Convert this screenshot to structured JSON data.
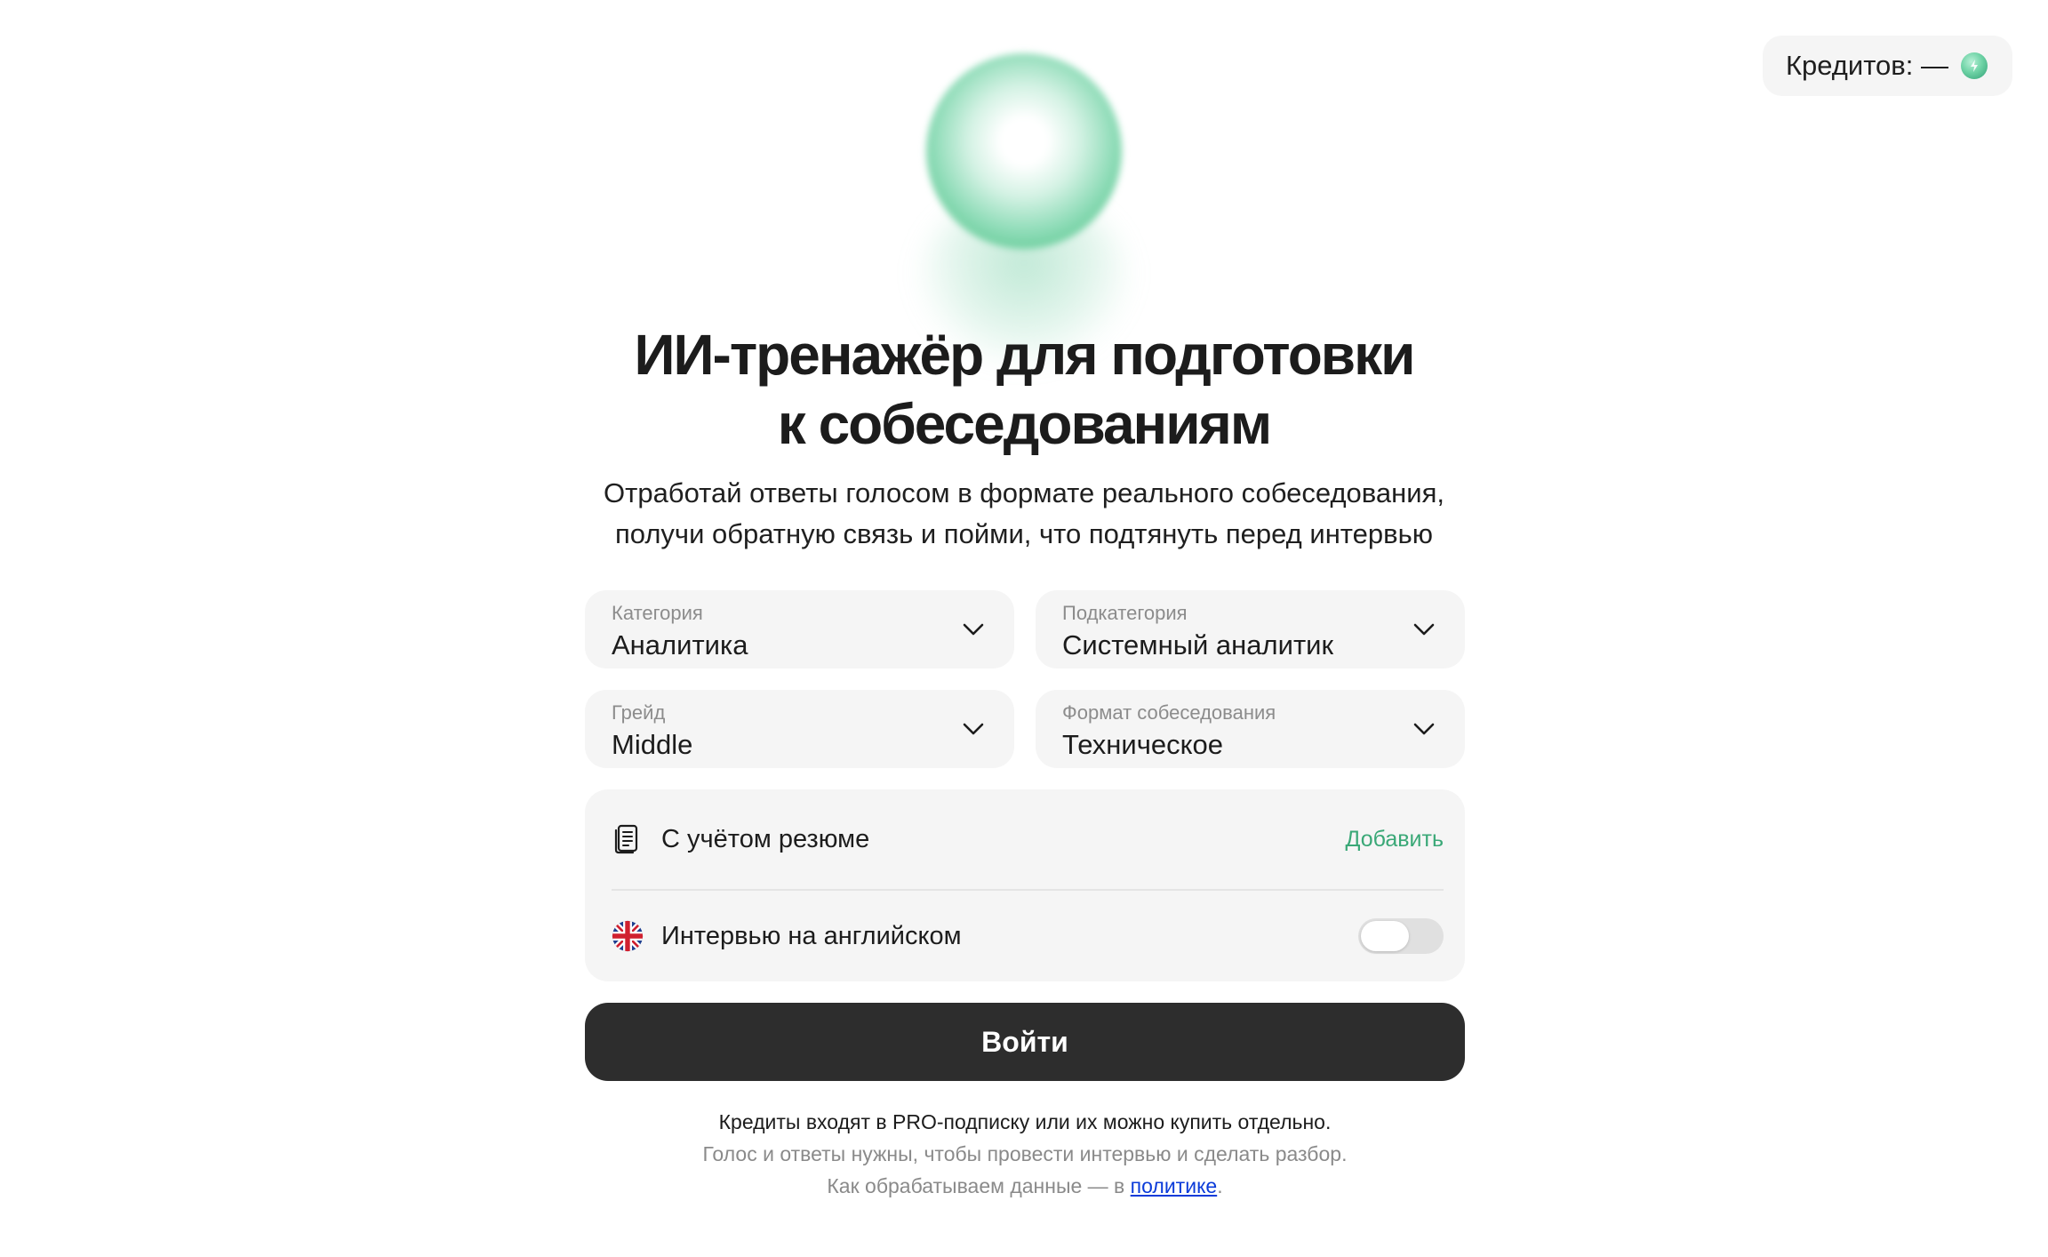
{
  "header": {
    "credits_label": "Кредитов: —"
  },
  "hero": {
    "title_line1": "ИИ-тренажёр для подготовки",
    "title_line2": "к собеседованиям",
    "subtitle_line1": "Отработай ответы голосом в формате реального собеседования,",
    "subtitle_line2": "получи обратную связь и пойми, что подтянуть перед интервью"
  },
  "form": {
    "category": {
      "label": "Категория",
      "value": "Аналитика"
    },
    "subcategory": {
      "label": "Подкатегория",
      "value": "Системный аналитик"
    },
    "grade": {
      "label": "Грейд",
      "value": "Middle"
    },
    "format": {
      "label": "Формат собеседования",
      "value": "Техническое"
    },
    "resume": {
      "label": "С учётом резюме",
      "action": "Добавить",
      "icon": "document-icon"
    },
    "english": {
      "label": "Интервью на английском",
      "enabled": false,
      "icon": "uk-flag-icon"
    },
    "submit_label": "Войти"
  },
  "footer": {
    "note1": "Кредиты входят в PRO-подписку или их можно купить отдельно.",
    "note2": "Голос и ответы нужны, чтобы провести интервью и сделать разбор.",
    "note3_prefix": "Как обрабатываем данные — в ",
    "note3_link": "политике",
    "note3_suffix": "."
  },
  "colors": {
    "accent": "#3aa877",
    "button": "#2d2d2d",
    "field_bg": "#f5f5f5",
    "link": "#0b3bd9"
  }
}
